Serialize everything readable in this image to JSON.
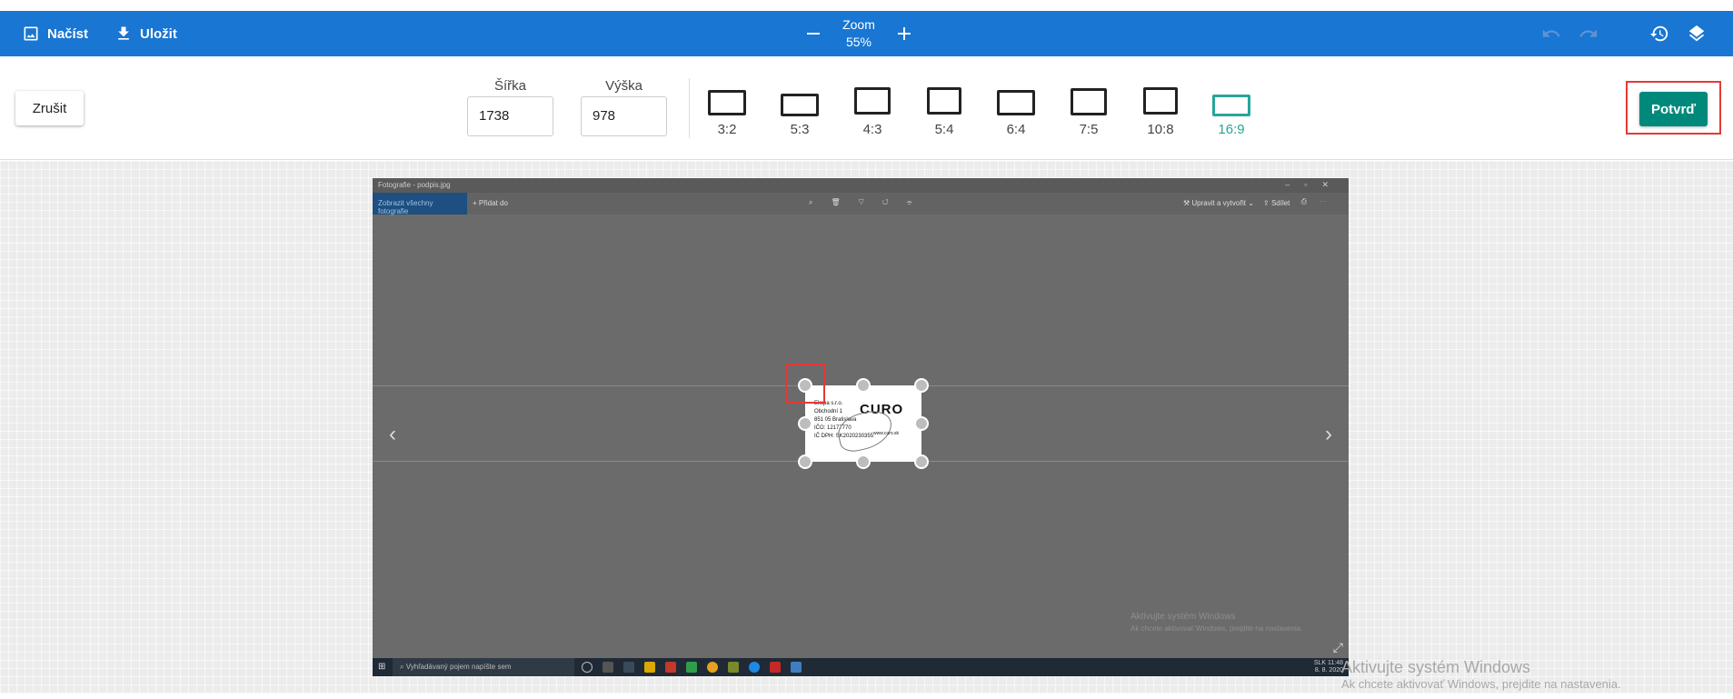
{
  "header": {
    "load_label": "Načíst",
    "save_label": "Uložit",
    "zoom_label": "Zoom",
    "zoom_value": "55%"
  },
  "toolbar": {
    "cancel_label": "Zrušit",
    "width_label": "Šířka",
    "width_value": "1738",
    "height_label": "Výška",
    "height_value": "978",
    "ratios": [
      "3:2",
      "5:3",
      "4:3",
      "5:4",
      "6:4",
      "7:5",
      "10:8",
      "16:9"
    ],
    "active_ratio": "16:9",
    "confirm_label": "Potvrď"
  },
  "photo": {
    "title": "Fotografie - podpis.jpg",
    "all_photos": "Zobrazit všechny fotografie",
    "add_to": "Přidat do",
    "edit_create": "Upravit a vytvořit",
    "share": "Sdílet",
    "card": {
      "lines": [
        "Ekspa s.r.o.",
        "Obchodní 1",
        "851 05 Bratislava",
        "IČO: 12177770",
        "IČ DPH: SK2020230355"
      ],
      "logo": "CURO",
      "web": "www.curo.sk"
    },
    "watermark_title": "Aktivujte systém Windows",
    "watermark_sub": "Ak chcete aktivovať Windows, prejdite na nastavenia.",
    "taskbar_search": "Vyhľadávaný pojem napíšte sem",
    "tray_lang": "SLK",
    "tray_time": "11:48",
    "tray_date": "8. 8. 2020"
  },
  "os_watermark": {
    "title": "Aktivujte systém Windows",
    "sub": "Ak chcete aktivovať Windows, prejdite na nastavenia."
  },
  "colors": {
    "header_bg": "#1976d2",
    "accent": "#00897b",
    "active_ratio": "#26a69a",
    "highlight": "#e53935"
  }
}
